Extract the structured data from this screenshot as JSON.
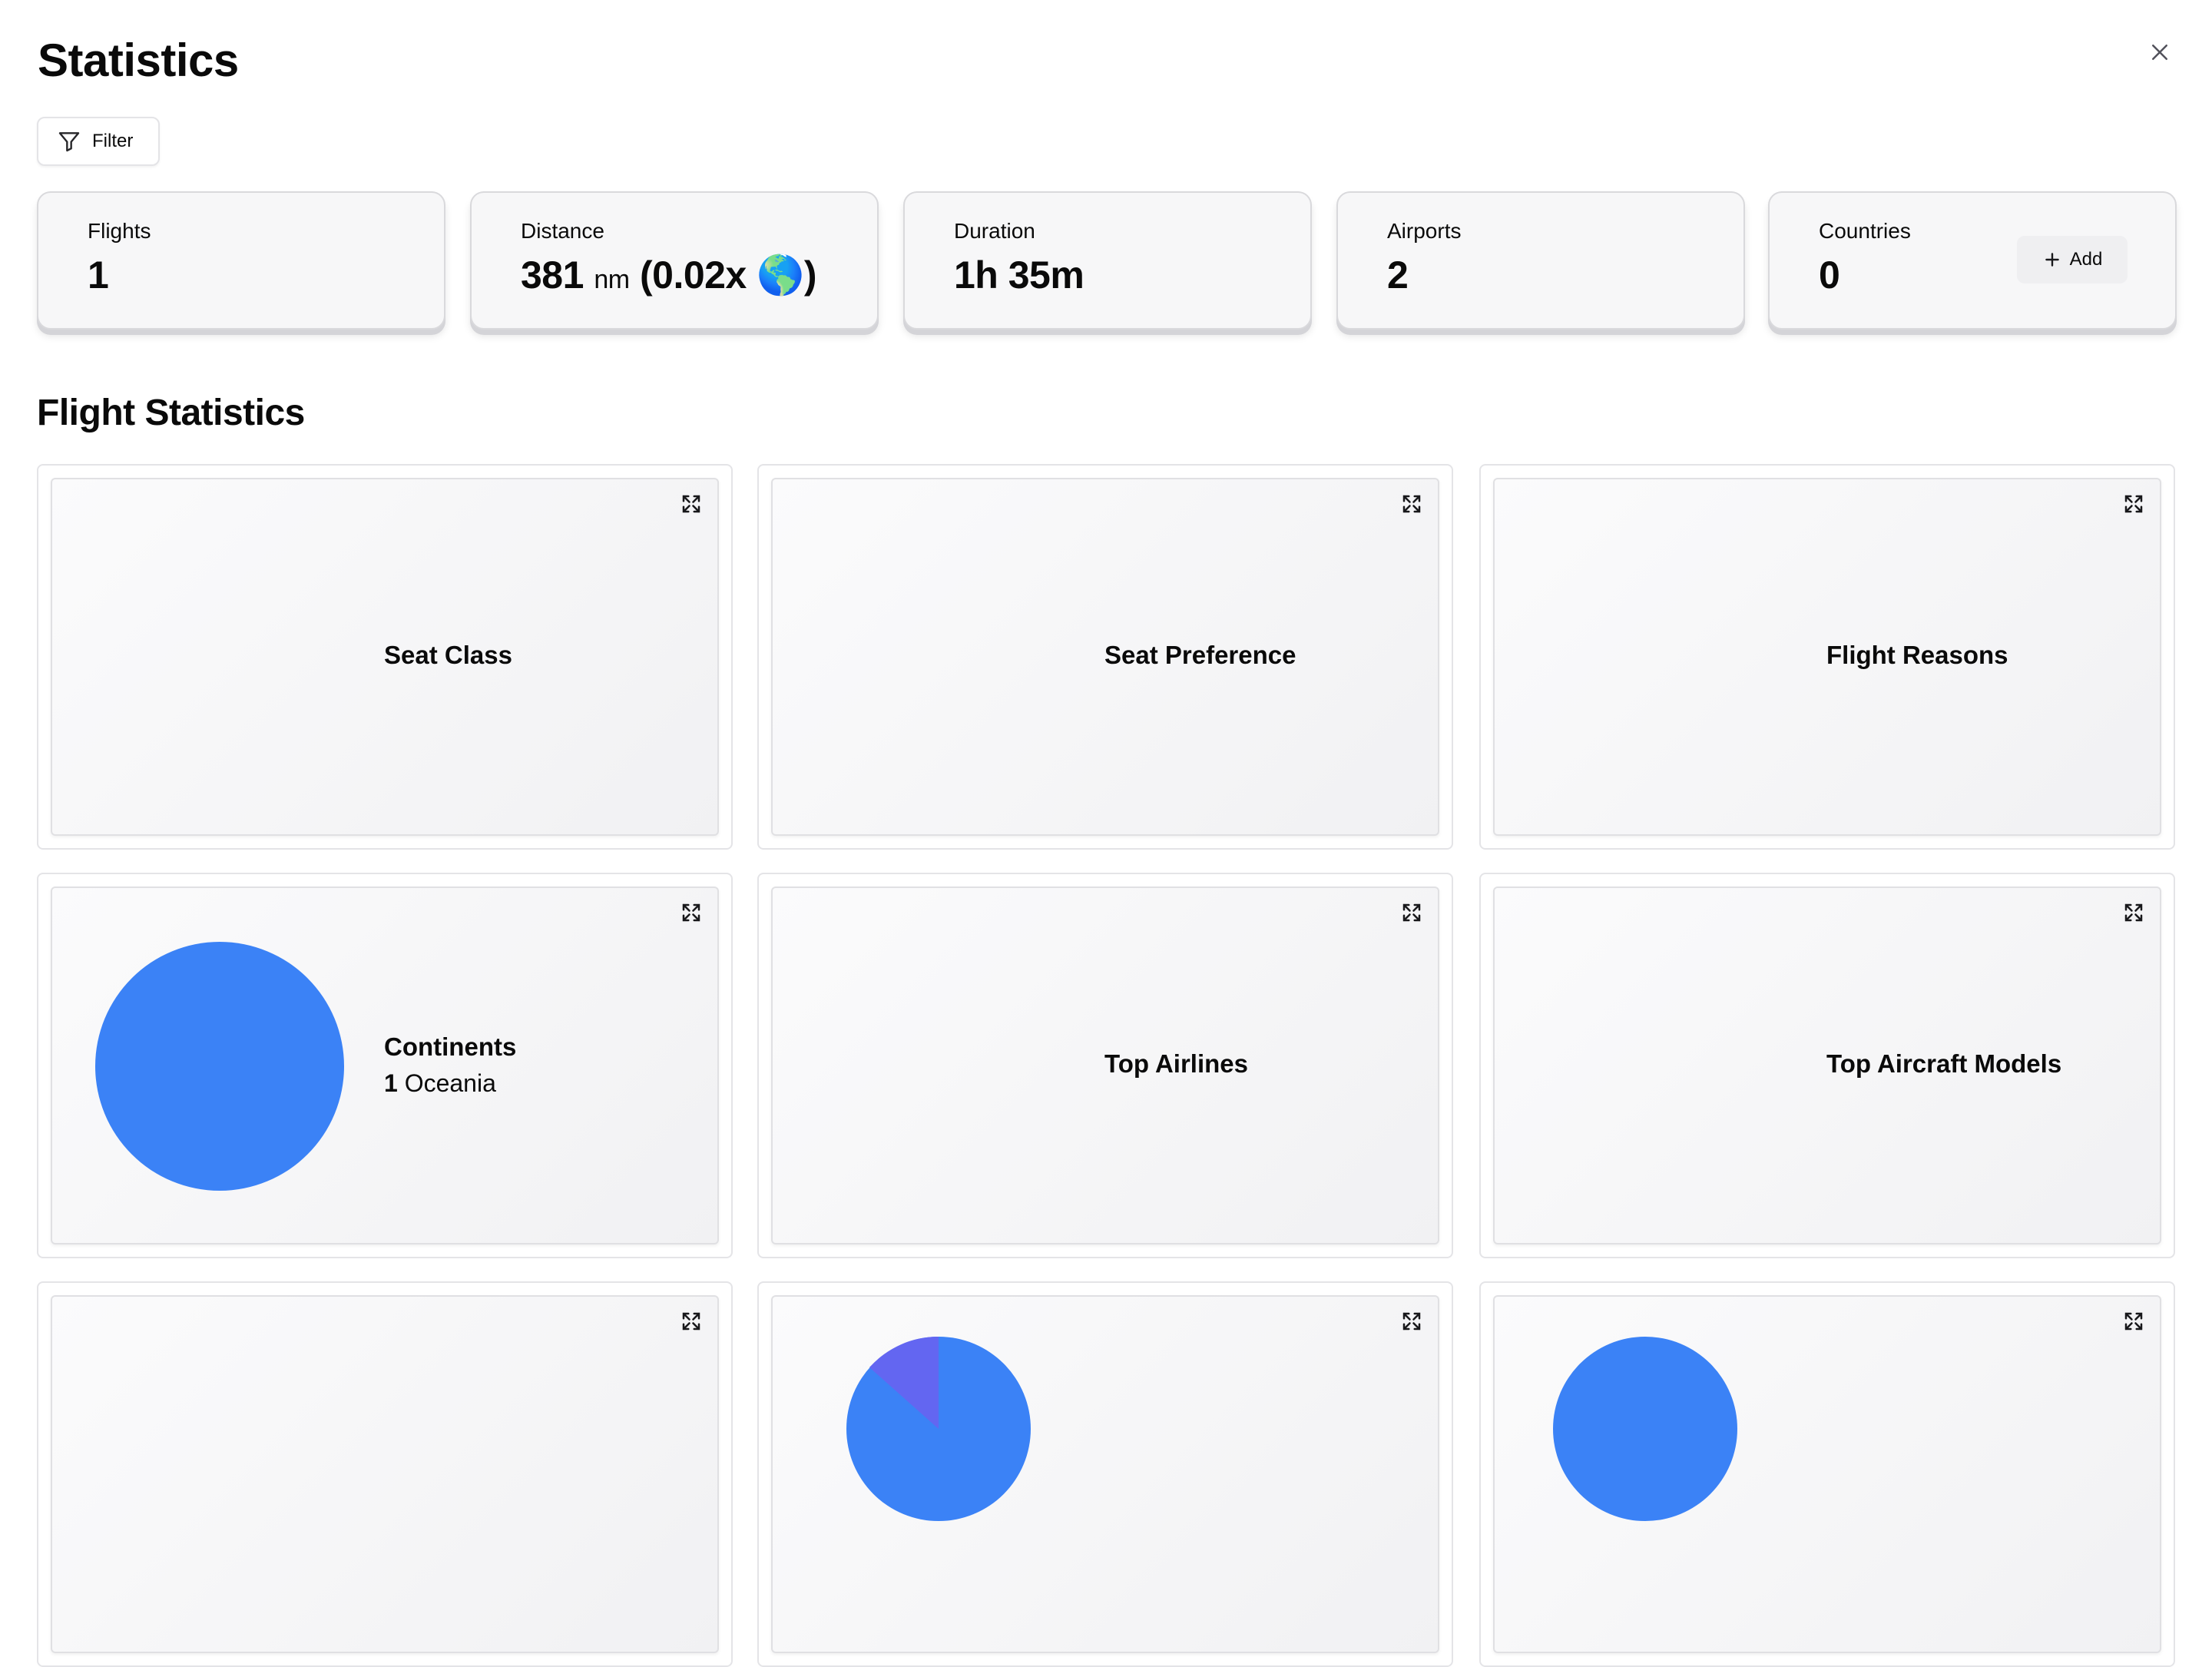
{
  "header": {
    "title": "Statistics"
  },
  "filter": {
    "label": "Filter"
  },
  "stats": {
    "flights": {
      "label": "Flights",
      "value": "1"
    },
    "distance": {
      "label": "Distance",
      "value": "381",
      "unit": "nm",
      "extra": "(0.02x 🌎)"
    },
    "duration": {
      "label": "Duration",
      "value": "1h 35m"
    },
    "airports": {
      "label": "Airports",
      "value": "2"
    },
    "countries": {
      "label": "Countries",
      "value": "0",
      "add_label": "Add"
    }
  },
  "section": {
    "title": "Flight Statistics"
  },
  "charts": {
    "seat_class": {
      "title": "Seat Class"
    },
    "seat_preference": {
      "title": "Seat Preference"
    },
    "flight_reasons": {
      "title": "Flight Reasons"
    },
    "continents": {
      "title": "Continents",
      "legend": [
        {
          "count": "1",
          "label": "Oceania"
        }
      ]
    },
    "top_airlines": {
      "title": "Top Airlines"
    },
    "top_aircraft": {
      "title": "Top Aircraft Models"
    }
  },
  "colors": {
    "accent_blue": "#3b82f6",
    "accent_purple": "#6366f1"
  },
  "chart_data": [
    {
      "type": "pie",
      "title": "Continents",
      "categories": [
        "Oceania"
      ],
      "values": [
        1
      ]
    }
  ]
}
